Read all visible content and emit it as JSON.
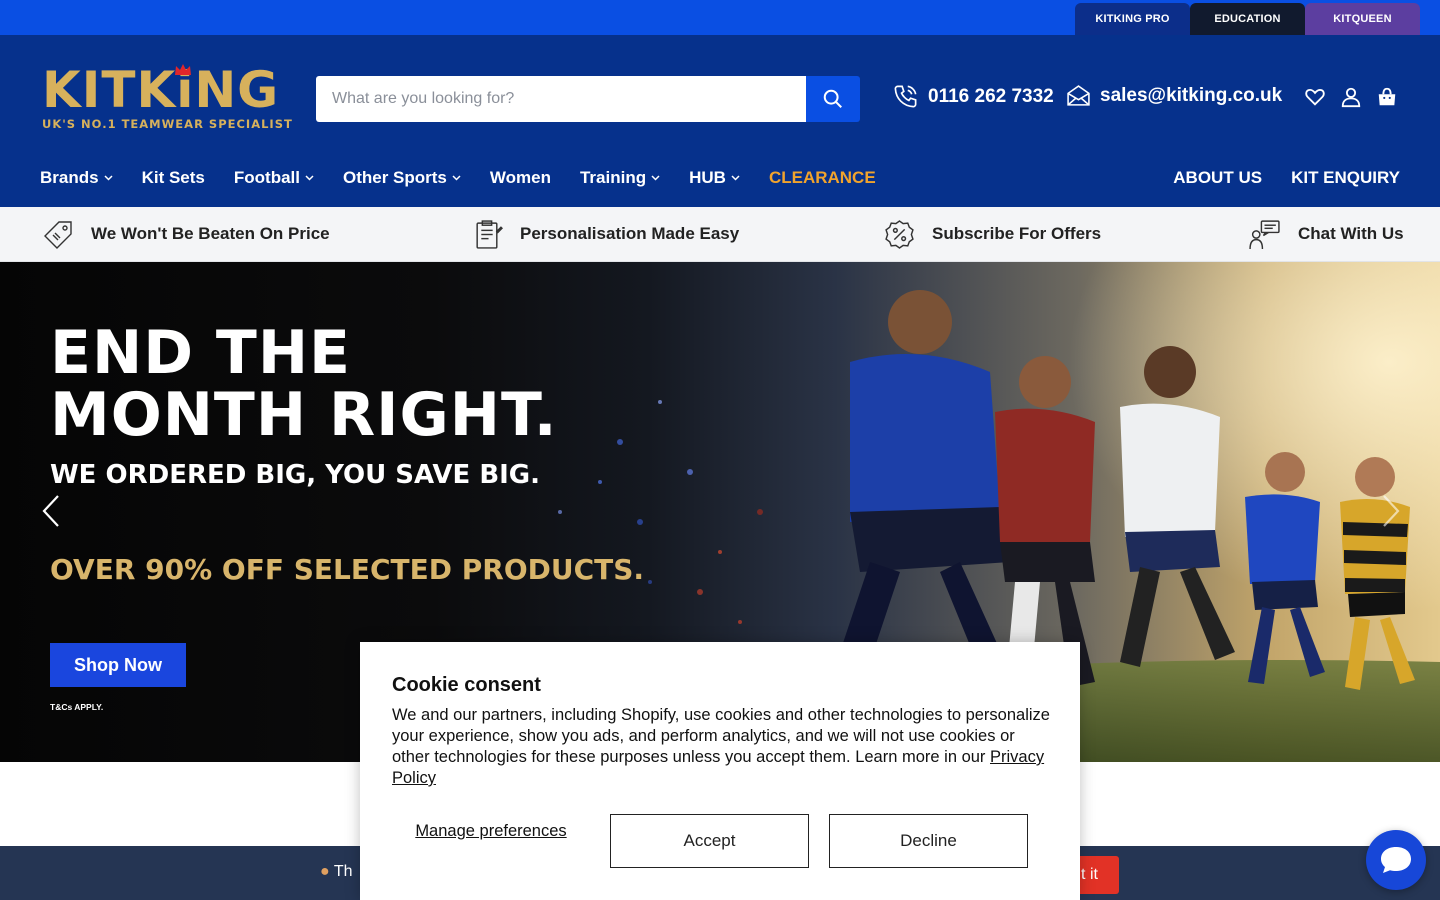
{
  "topbar": {
    "tabs": [
      {
        "label": "KITKING PRO"
      },
      {
        "label": "EDUCATION"
      },
      {
        "label": "KITQUEEN"
      }
    ]
  },
  "header": {
    "logo": {
      "word": "KITKiNG",
      "tagline": "UK'S NO.1 TEAMWEAR SPECIALIST"
    },
    "search": {
      "placeholder": "What are you looking for?"
    },
    "phone": "0116 262 7332",
    "email": "sales@kitking.co.uk",
    "icons": [
      "heart-icon",
      "account-icon",
      "cart-icon"
    ]
  },
  "nav": {
    "items": [
      {
        "label": "Brands",
        "dropdown": true
      },
      {
        "label": "Kit Sets",
        "dropdown": false
      },
      {
        "label": "Football",
        "dropdown": true
      },
      {
        "label": "Other Sports",
        "dropdown": true
      },
      {
        "label": "Women",
        "dropdown": false
      },
      {
        "label": "Training",
        "dropdown": true
      },
      {
        "label": "HUB",
        "dropdown": true
      },
      {
        "label": "CLEARANCE",
        "dropdown": false
      }
    ],
    "right": [
      {
        "label": "ABOUT US"
      },
      {
        "label": "KIT ENQUIRY"
      }
    ],
    "clearance_color": "#f0a32d"
  },
  "usp": {
    "items": [
      {
        "label": "We Won't Be Beaten On Price",
        "icon": "price-tag-icon"
      },
      {
        "label": "Personalisation Made Easy",
        "icon": "clipboard-icon"
      },
      {
        "label": "Subscribe For Offers",
        "icon": "percent-badge-icon"
      },
      {
        "label": "Chat With Us",
        "icon": "chat-person-icon"
      }
    ]
  },
  "hero": {
    "line1": "END THE",
    "line2": "MONTH RIGHT.",
    "subtitle": "WE ORDERED BIG, YOU SAVE BIG.",
    "offer": "OVER 90% OFF SELECTED PRODUCTS.",
    "cta": "Shop Now",
    "terms": "T&Cs APPLY."
  },
  "cookie": {
    "title": "Cookie consent",
    "body": "We and our partners, including Shopify, use cookies and other technologies to personalize your experience, show you ads, and perform analytics, and we will not use cookies or other technologies for these purposes unless you accept them. Learn more in our ",
    "link": "Privacy Policy",
    "manage": "Manage preferences",
    "accept": "Accept",
    "decline": "Decline"
  },
  "bottom_strip": {
    "text": "Th",
    "button": "t it"
  },
  "colors": {
    "topbar": "#0a4fe3",
    "header": "#06318c",
    "gold": "#d7b15c",
    "cta": "#1a46de"
  }
}
